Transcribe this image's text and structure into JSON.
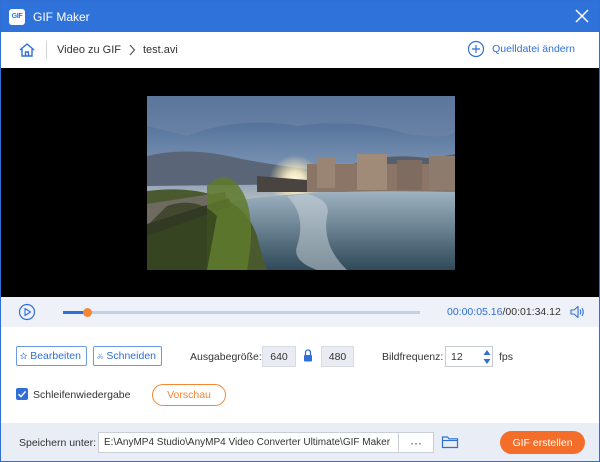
{
  "window": {
    "title": "GIF Maker",
    "app_icon_text": "GIF",
    "accent_color": "#2f72da",
    "orange_color": "#f58634"
  },
  "nav": {
    "breadcrumb": [
      "Video zu GIF",
      "test.avi"
    ],
    "source_change_label": "Quelldatei ändern",
    "icons": [
      "home-icon",
      "chevron-right-icon",
      "plus-circle-icon",
      "close-icon"
    ]
  },
  "player": {
    "current_time": "00:00:05.16",
    "separator": "/",
    "total_time": "00:01:34.12",
    "progress_fraction": 0.067,
    "icons": [
      "play-icon",
      "volume-icon"
    ]
  },
  "options": {
    "edit_label": "Bearbeiten",
    "cut_label": "Schneiden",
    "output_size_label": "Ausgabegröße:",
    "width": "640",
    "height": "480",
    "frame_rate_label": "Bildfrequenz:",
    "frame_rate": "12",
    "fps_unit": "fps",
    "loop_label": "Schleifenwiedergabe",
    "loop_checked": true,
    "preview_label": "Vorschau",
    "icons": [
      "star-edit-icon",
      "scissors-icon",
      "lock-icon",
      "checkmark-icon"
    ]
  },
  "footer": {
    "save_label": "Speichern unter:",
    "save_path": "E:\\AnyMP4 Studio\\AnyMP4 Video Converter Ultimate\\GIF Maker",
    "browse_label": "···",
    "create_label": "GIF erstellen",
    "icons": [
      "folder-icon"
    ]
  }
}
